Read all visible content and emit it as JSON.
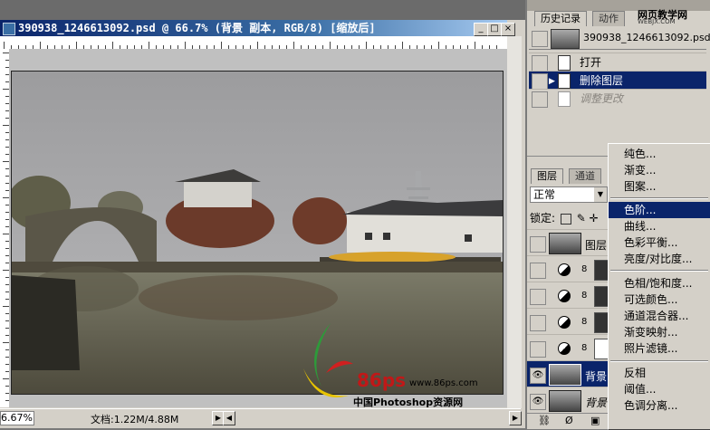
{
  "document": {
    "title": "390938_1246613092.psd @ 66.7% (背景 副本, RGB/8) [缩放后]",
    "zoom": "6.67%",
    "doc_size": "文档:1.22M/4.88M",
    "window_buttons": [
      "_",
      "□",
      "×"
    ]
  },
  "watermark": {
    "logo_text": "86ps",
    "url": "www.86ps.com",
    "site_name": "中国Photoshop资源网"
  },
  "brand": {
    "name": "网页教学网",
    "url": "WEBJX.COM"
  },
  "history_panel": {
    "tabs": [
      "历史记录",
      "动作"
    ],
    "snapshot_name": "390938_1246613092.psd",
    "steps": [
      {
        "label": "打开",
        "state": "normal"
      },
      {
        "label": "删除图层",
        "state": "selected"
      },
      {
        "label": "调整更改",
        "state": "disabled"
      }
    ]
  },
  "layers_panel": {
    "tabs": [
      "图层",
      "通道"
    ],
    "blend_mode": "正常",
    "lock_label": "锁定:",
    "layers": [
      {
        "name": "图层",
        "type": "image",
        "visible": false
      },
      {
        "name": "",
        "type": "adjustment",
        "visible": false
      },
      {
        "name": "",
        "type": "adjustment",
        "visible": false
      },
      {
        "name": "",
        "type": "adjustment",
        "visible": false
      },
      {
        "name": "",
        "type": "adjustment",
        "visible": false
      },
      {
        "name": "背景",
        "type": "image",
        "visible": true,
        "selected": true
      },
      {
        "name": "背景",
        "type": "image",
        "visible": true,
        "italic": true
      }
    ]
  },
  "adjust_menu": {
    "groups": [
      [
        "纯色...",
        "渐变...",
        "图案..."
      ],
      [
        "色阶...",
        "曲线...",
        "色彩平衡...",
        "亮度/对比度..."
      ],
      [
        "色相/饱和度...",
        "可选颜色...",
        "通道混合器...",
        "渐变映射...",
        "照片滤镜..."
      ],
      [
        "反相",
        "阈值...",
        "色调分离..."
      ]
    ],
    "highlighted": "色阶..."
  },
  "colors": {
    "title_bar": "#0a246a",
    "panel_bg": "#d4d0c8",
    "highlight": "#0a246a"
  }
}
